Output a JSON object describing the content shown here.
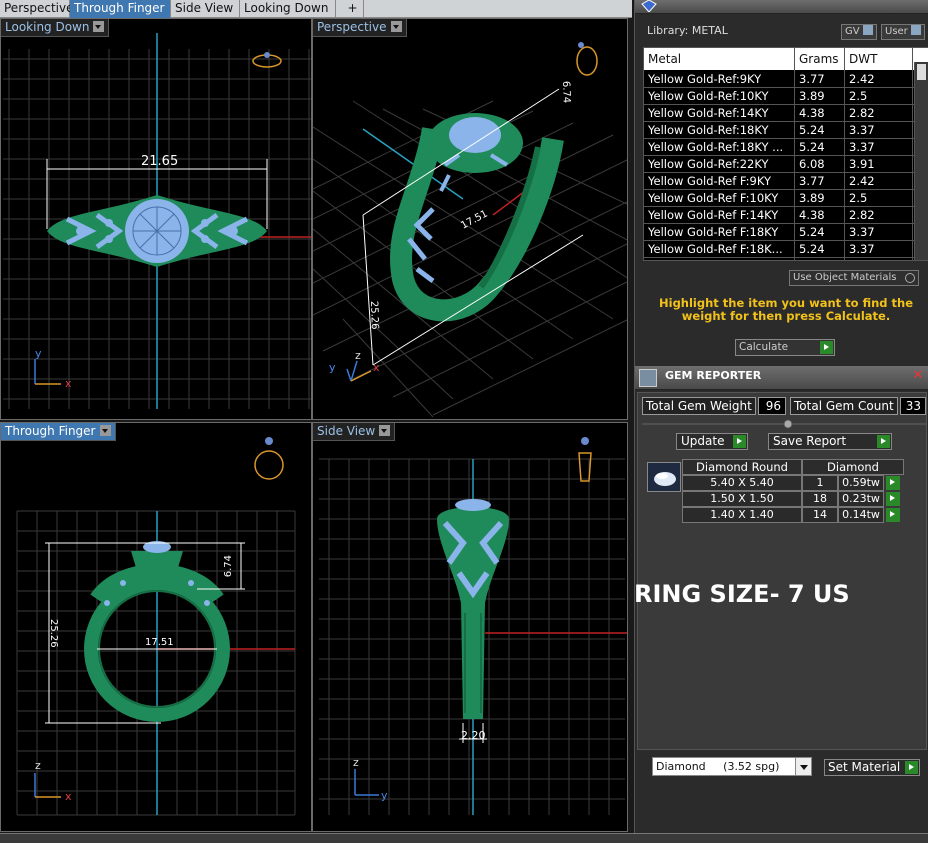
{
  "tabs": [
    {
      "label": "Perspective",
      "active": false
    },
    {
      "label": "Through Finger",
      "active": true
    },
    {
      "label": "Side View",
      "active": false
    },
    {
      "label": "Looking Down",
      "active": false
    }
  ],
  "add_tab": "+",
  "viewports": {
    "top_left": {
      "label": "Looking Down",
      "dimension": "21.65",
      "axis_v": "y",
      "axis_h": "x"
    },
    "top_right": {
      "label": "Perspective",
      "dim_height": "6.74",
      "dim_width": "17.51",
      "dim_length": "25.26",
      "axis_a": "y",
      "axis_b": "z",
      "axis_c": "x"
    },
    "bot_left": {
      "label": "Through Finger",
      "dim_height": "6.74",
      "dim_width": "17.51",
      "dim_vertical": "25.26",
      "axis_v": "z",
      "axis_h": "x"
    },
    "bot_right": {
      "label": "Side View",
      "dimension": "2.20",
      "axis_v": "z",
      "axis_h": "y"
    }
  },
  "metal_library": {
    "title_label": "Library: METAL",
    "gv_label": "GV",
    "user_label": "User",
    "columns": [
      "Metal",
      "Grams",
      "DWT"
    ],
    "rows": [
      [
        "Yellow Gold-Ref:9KY",
        "3.77",
        "2.42"
      ],
      [
        "Yellow Gold-Ref:10KY",
        "3.89",
        "2.5"
      ],
      [
        "Yellow Gold-Ref:14KY",
        "4.38",
        "2.82"
      ],
      [
        "Yellow Gold-Ref:18KY",
        "5.24",
        "3.37"
      ],
      [
        "Yellow Gold-Ref:18KY ...",
        "5.24",
        "3.37"
      ],
      [
        "Yellow Gold-Ref:22KY",
        "6.08",
        "3.91"
      ],
      [
        "Yellow Gold-Ref F:9KY",
        "3.77",
        "2.42"
      ],
      [
        "Yellow Gold-Ref F:10KY",
        "3.89",
        "2.5"
      ],
      [
        "Yellow Gold-Ref F:14KY",
        "4.38",
        "2.82"
      ],
      [
        "Yellow Gold-Ref F:18KY",
        "5.24",
        "3.37"
      ],
      [
        "Yellow Gold-Ref F:18K...",
        "5.24",
        "3.37"
      ]
    ],
    "use_object_materials": "Use Object Materials",
    "hint": "Highlight the item you want to find the weight for then press Calculate.",
    "calculate_label": "Calculate"
  },
  "gem_reporter": {
    "title": "GEM REPORTER",
    "total_weight_label": "Total Gem Weight",
    "total_weight_value": "96",
    "total_count_label": "Total Gem Count",
    "total_count_value": "33",
    "update_label": "Update",
    "save_report_label": "Save Report",
    "table_header": [
      "Diamond Round",
      "Diamond"
    ],
    "rows": [
      [
        "5.40 X 5.40",
        "1",
        "0.59tw"
      ],
      [
        "1.50 X 1.50",
        "18",
        "0.23tw"
      ],
      [
        "1.40 X 1.40",
        "14",
        "0.14tw"
      ]
    ],
    "material_value": "Diamond     (3.52 spg)",
    "set_material_label": "Set Material"
  },
  "overlay_text": "RING SIZE- 7 US",
  "colors": {
    "ring_green": "#1f8a5a",
    "prong_blue": "#8ab4ea",
    "hint_yellow": "#f2c21a",
    "tab_active": "#3f78b0"
  }
}
